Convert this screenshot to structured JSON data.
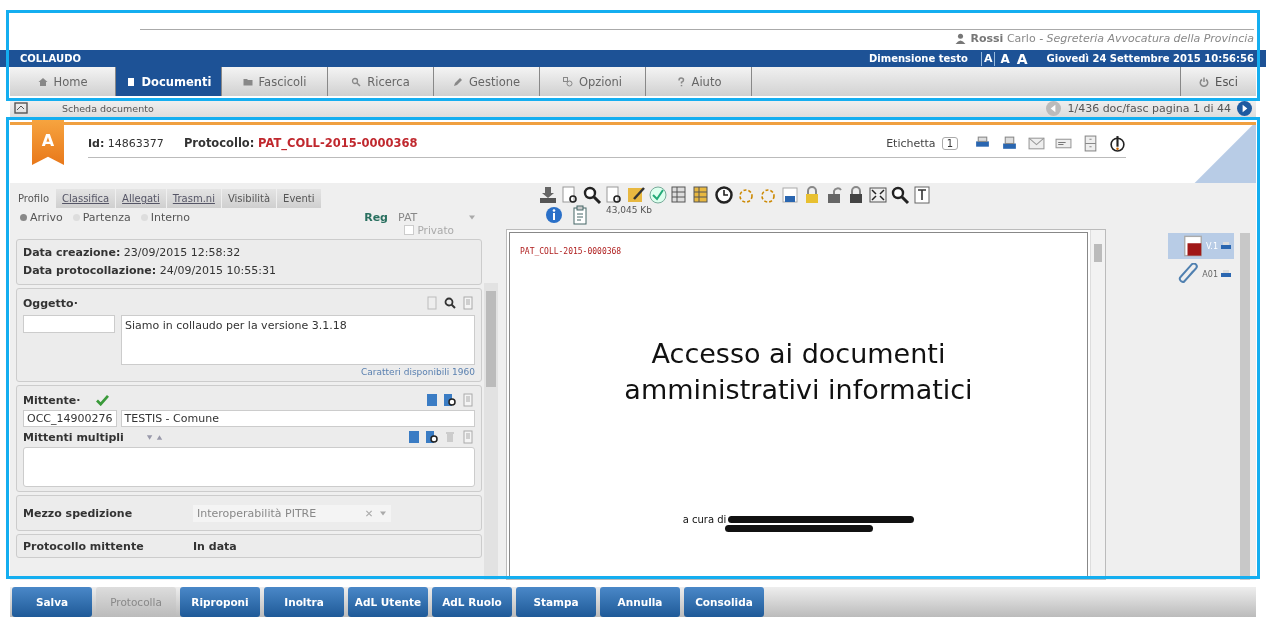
{
  "user": {
    "surname": "Rossi",
    "name": "Carlo",
    "office": "- Segreteria Avvocatura della Provincia"
  },
  "environment": "COLLAUDO",
  "text_size": {
    "label": "Dimensione testo",
    "options": [
      {
        "label": "A",
        "selected": true
      },
      {
        "label": "A",
        "selected": false
      },
      {
        "label": "A",
        "selected": false
      }
    ]
  },
  "datetime": "Giovedì 24 Settembre 2015 10:56:56",
  "nav_tabs": [
    {
      "label": "Home",
      "selected": false
    },
    {
      "label": "Documenti",
      "selected": true
    },
    {
      "label": "Fascicoli",
      "selected": false
    },
    {
      "label": "Ricerca",
      "selected": false
    },
    {
      "label": "Gestione",
      "selected": false
    },
    {
      "label": "Opzioni",
      "selected": false
    },
    {
      "label": "Aiuto",
      "selected": false
    }
  ],
  "logout": "Esci",
  "breadcrumb": "Scheda documento",
  "pager": "1/436 doc/fasc pagina 1 di 44",
  "document": {
    "ribbon": "A",
    "id_label": "Id:",
    "id": "14863377",
    "protocol_label": "Protocollo:",
    "protocol": "PAT_COLL-2015-0000368",
    "label_caption": "Etichetta",
    "label_count": "1"
  },
  "profile_tabs": [
    {
      "label": "Profilo",
      "selected": true,
      "kind": "plain"
    },
    {
      "label": "Classifica",
      "selected": false,
      "kind": "link"
    },
    {
      "label": "Allegati",
      "selected": false,
      "kind": "link"
    },
    {
      "label": "Trasm.ni",
      "selected": false,
      "kind": "link"
    },
    {
      "label": "Visibilità",
      "selected": false,
      "kind": "plain"
    },
    {
      "label": "Eventi",
      "selected": false,
      "kind": "plain"
    }
  ],
  "direction": [
    {
      "label": "Arrivo",
      "selected": true
    },
    {
      "label": "Partenza",
      "selected": false
    },
    {
      "label": "Interno",
      "selected": false
    }
  ],
  "register": {
    "label": "Reg",
    "value": "PAT"
  },
  "private": {
    "label": "Privato",
    "checked": false
  },
  "dates": [
    {
      "label": "Data creazione:",
      "value": "23/09/2015 12:58:32"
    },
    {
      "label": "Data protocollazione:",
      "value": "24/09/2015 10:55:31"
    }
  ],
  "subject": {
    "label": "Oggetto·",
    "text": "Siamo in collaudo per la versione 3.1.18",
    "counter": "Caratteri disponibili 1960"
  },
  "sender": {
    "label": "Mittente·",
    "verified": true,
    "code": "OCC_14900276",
    "name": "TESTIS - Comune",
    "multiple_label": "Mittenti multipli"
  },
  "shipping": {
    "label": "Mezzo spedizione",
    "value": "Interoperabilità PITRE"
  },
  "cut_fields": [
    "Protocollo mittente",
    "In data"
  ],
  "viewer": {
    "file_size": "43,045 Kb",
    "page_header": "PAT_COLL-2015-0000368",
    "title": "Accesso ai documenti amministrativi informatici",
    "credit": "a cura di"
  },
  "versions": [
    {
      "label": "V.1",
      "selected": true
    },
    {
      "label": "A01",
      "selected": false
    }
  ],
  "actions": [
    {
      "label": "Salva",
      "disabled": false
    },
    {
      "label": "Protocolla",
      "disabled": true
    },
    {
      "label": "Riproponi",
      "disabled": false
    },
    {
      "label": "Inoltra",
      "disabled": false
    },
    {
      "label": "AdL Utente",
      "disabled": false
    },
    {
      "label": "AdL Ruolo",
      "disabled": false
    },
    {
      "label": "Stampa",
      "disabled": false
    },
    {
      "label": "Annulla",
      "disabled": false
    },
    {
      "label": "Consolida",
      "disabled": false
    }
  ]
}
